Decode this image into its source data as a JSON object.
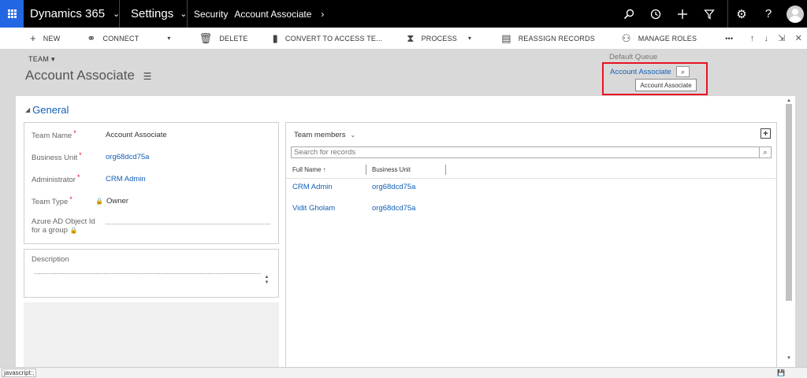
{
  "nav": {
    "app_name": "Dynamics 365",
    "area": "Settings",
    "breadcrumb_1": "Security",
    "breadcrumb_2": "Account Associate"
  },
  "command_bar": {
    "new": "New",
    "connect": "Connect",
    "delete": "Delete",
    "convert": "Convert to Access Te...",
    "process": "Process",
    "reassign": "Reassign Records",
    "manage_roles": "Manage Roles",
    "more": "•••"
  },
  "header": {
    "entity_type": "TEAM",
    "record_name": "Account Associate",
    "default_queue_label": "Default Queue",
    "default_queue_value": "Account Associate",
    "default_queue_tooltip": "Account Associate"
  },
  "general": {
    "section_title": "General",
    "fields": [
      {
        "label": "Team Name",
        "required": "*",
        "value": "Account Associate"
      },
      {
        "label": "Business Unit",
        "required": "*",
        "value": "org68dcd75a"
      },
      {
        "label": "Administrator",
        "required": "*",
        "value": "CRM Admin"
      },
      {
        "label": "Team Type",
        "required": "*",
        "value": "Owner"
      },
      {
        "label": "Azure AD Object Id for a group",
        "value": ""
      }
    ],
    "description_label": "Description"
  },
  "subgrid": {
    "title": "Team members",
    "search_placeholder": "Search for records",
    "columns": [
      "Full Name",
      "Business Unit"
    ],
    "sort_indicator": "↑",
    "rows": [
      {
        "full_name": "CRM Admin",
        "business_unit": "org68dcd75a"
      },
      {
        "full_name": "Vidit Gholam",
        "business_unit": "org68dcd75a"
      }
    ]
  },
  "status_bar": {
    "text": "javascript:;"
  },
  "colors": {
    "nav_bg": "#000000",
    "waffle": "#2266e3",
    "link": "#1160b7",
    "highlight_border": "#e81123"
  }
}
